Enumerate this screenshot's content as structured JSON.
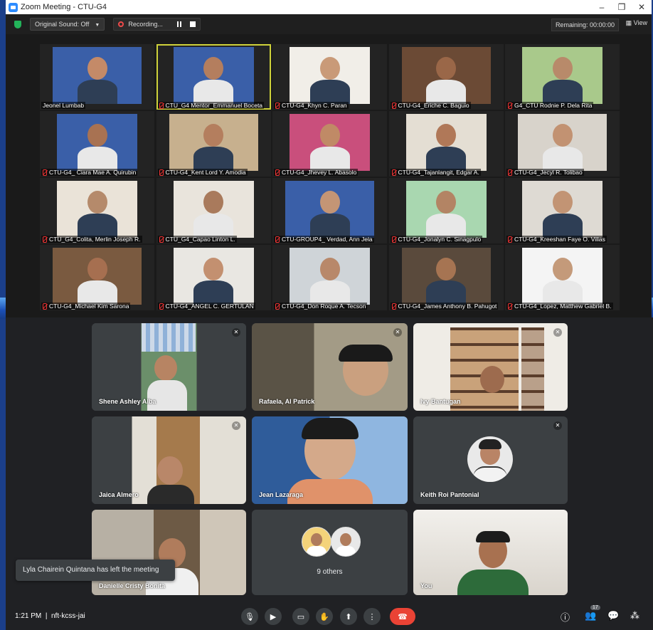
{
  "window": {
    "title": "Zoom Meeting - CTU-G4"
  },
  "zoom_toolbar": {
    "original_sound": "Original Sound: Off",
    "recording": "Recording...",
    "remaining": "Remaining: 00:00:00",
    "view": "View"
  },
  "zoom_participants": [
    "Jeonel Lumbab",
    "CTU_G4 Mentor_Emmanuel Boceta",
    "CTU-G4_Khyn C. Paran",
    "CTU-G4_Eriche C. Baguio",
    "G4_CTU Rodnie P. Dela Rita",
    "CTU-G4_ Ciara Mae A. Quirubin",
    "CTU-G4_Kent Lord Y. Amodia",
    "CTU-G4_Jhevey L. Abasolo",
    "CTU-G4_Tajanlangit, Edgar A.",
    "CTU-G4_Jecyl R. Tolibao",
    "CTU_G4_Colita, Merlin Joseph R.",
    "CTU_G4_Capao Linton L.",
    "CTU-GROUP4_ Verdad, Ann Jela",
    "CTU-G4_Jonalyn C. Sinagpulo",
    "CTU-G4_Kreeshan Faye O. Villas",
    "CTU-G4_Michael Kim Sarona",
    "CTU-G4_ANGEL C. GERTULAN",
    "CTU-G4_Don Roque A. Tecson",
    "CTU-G4_James Anthony B. Pahugot",
    "CTU-G4_Lopez, Matthew Gabriel B."
  ],
  "meet_tiles": [
    {
      "name": "Shene Ashley Alba"
    },
    {
      "name": "Rafaela, Al Patrick"
    },
    {
      "name": "Ivy Bantugan"
    },
    {
      "name": "Jaica Almero"
    },
    {
      "name": "Jean Lazaraga"
    },
    {
      "name": "Keith Roi Pantonial"
    },
    {
      "name": "Danielle Cristy Bonita"
    },
    {
      "name": "9 others"
    },
    {
      "name": "You"
    }
  ],
  "meet_notification": "Lyla Chairein Quintana has left the meeting",
  "meet_bottom": {
    "time": "1:21 PM",
    "separator": "|",
    "meeting_code": "nft-kcss-jai",
    "people_count": "17"
  },
  "colors": {
    "end_call": "#ea4335",
    "active_speaker": "#cfd23a",
    "desktop": "#1b3f8a"
  }
}
